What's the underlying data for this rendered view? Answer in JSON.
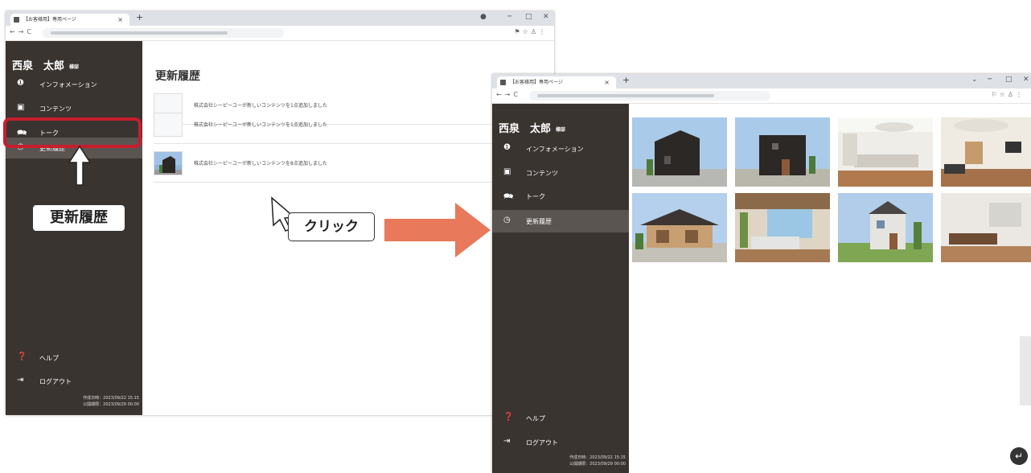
{
  "left_window": {
    "tab_title": "【お客様用】専用ページ",
    "tab_close": "×",
    "new_tab": "+",
    "user": {
      "name": "西泉　太郎",
      "honorific": "様邸"
    },
    "nav": [
      {
        "icon": "info-icon",
        "label": "インフォメーション"
      },
      {
        "icon": "image-icon",
        "label": "コンテンツ"
      },
      {
        "icon": "chat-icon",
        "label": "トーク"
      },
      {
        "icon": "history-icon",
        "label": "更新履歴"
      }
    ],
    "footer": [
      {
        "icon": "help-icon",
        "label": "ヘルプ"
      },
      {
        "icon": "logout-icon",
        "label": "ログアウト"
      }
    ],
    "meta": {
      "created": "作成日時：2023/09/22 15:15",
      "published": "公開期限：2023/09/29 00:00"
    },
    "main": {
      "title": "更新履歴",
      "rows": [
        {
          "text": "株式会社シーピーユーが新しいコンテンツを1点追加しました"
        },
        {
          "text": "株式会社シーピーユーが新しいコンテンツを1点追加しました"
        },
        {
          "text": "株式会社シーピーユーが新しいコンテンツを8点追加しました"
        }
      ]
    }
  },
  "annotations": {
    "history_label": "更新履歴",
    "click_label": "クリック",
    "highlight_color": "#c81e2c",
    "arrow_color": "#e8795a"
  },
  "right_window": {
    "tab_title": "【お客様用】専用ページ",
    "tab_close": "×",
    "new_tab": "+",
    "user": {
      "name": "西泉　太郎",
      "honorific": "様邸"
    },
    "nav": [
      {
        "icon": "info-icon",
        "label": "インフォメーション"
      },
      {
        "icon": "image-icon",
        "label": "コンテンツ"
      },
      {
        "icon": "chat-icon",
        "label": "トーク"
      },
      {
        "icon": "history-icon",
        "label": "更新履歴"
      }
    ],
    "footer": [
      {
        "icon": "help-icon",
        "label": "ヘルプ"
      },
      {
        "icon": "logout-icon",
        "label": "ログアウト"
      }
    ],
    "meta": {
      "created": "作成日時：2023/09/22 15:15",
      "published": "公開期限：2023/09/29 00:00"
    },
    "images": [
      "house-exterior-dark-1",
      "house-exterior-dark-2",
      "kitchen-interior",
      "living-room-interior",
      "house-exterior-hip-roof",
      "terrace-interior",
      "house-exterior-two-story",
      "living-room-interior-2"
    ]
  }
}
